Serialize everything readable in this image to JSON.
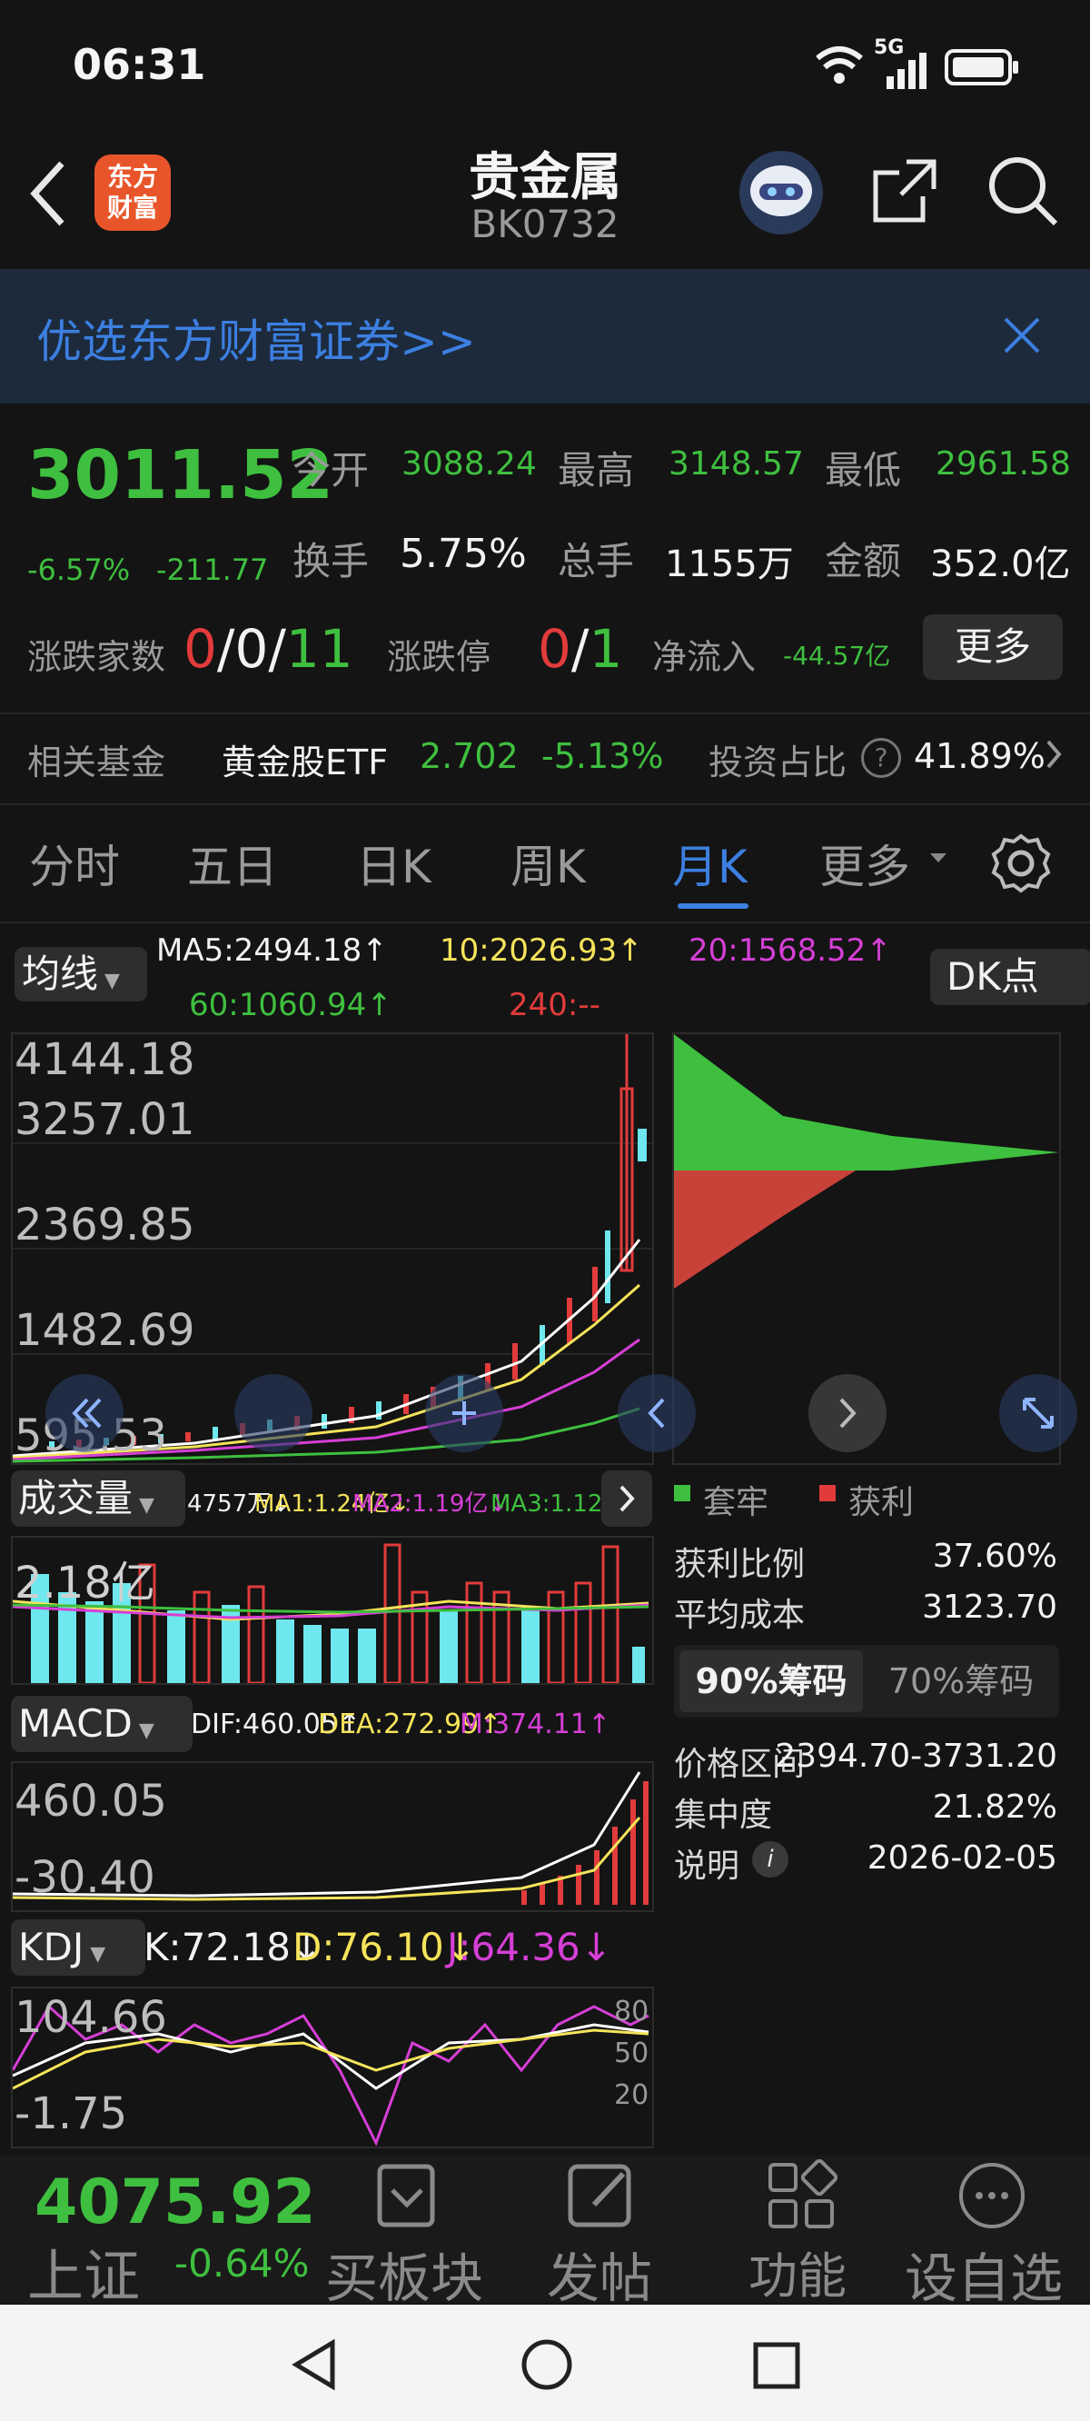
{
  "status_bar": {
    "time": "06:31",
    "network": "5G"
  },
  "header": {
    "title": "贵金属",
    "code": "BK0732",
    "logo_text_1": "东方",
    "logo_text_2": "财富"
  },
  "banner": {
    "text": "优选东方财富证券>>"
  },
  "quote": {
    "price": "3011.52",
    "change_pct": "-6.57%",
    "change": "-211.77",
    "open_label": "今开",
    "open": "3088.24",
    "high_label": "最高",
    "high": "3148.57",
    "low_label": "最低",
    "low": "2961.58",
    "turnover_label": "换手",
    "turnover": "5.75%",
    "volume_label": "总手",
    "volume": "1155万",
    "amount_label": "金额",
    "amount": "352.0亿",
    "updown_count_label": "涨跌家数",
    "up": "0",
    "flat": "0",
    "down": "11",
    "limit_label": "涨跌停",
    "limit_up": "0",
    "limit_down": "1",
    "netflow_label": "净流入",
    "netflow": "-44.57亿",
    "more_button": "更多"
  },
  "fund": {
    "label": "相关基金",
    "name": "黄金股ETF",
    "price": "2.702",
    "change": "-5.13%",
    "ratio_label": "投资占比",
    "ratio": "41.89%"
  },
  "tabs": [
    "分时",
    "五日",
    "日K",
    "周K",
    "月K",
    "更多"
  ],
  "ma": {
    "selector": "均线",
    "ma5": "MA5:2494.18↑",
    "ma10": "10:2026.93↑",
    "ma20": "20:1568.52↑",
    "ma60": "60:1060.94↑",
    "ma240": "240:--",
    "dk_button": "DK点"
  },
  "price_axis": [
    "4144.18",
    "3257.01",
    "2369.85",
    "1482.69",
    "595.53"
  ],
  "volume": {
    "selector": "成交量",
    "vol": "4757万↓",
    "ma1": "MA1:1.24亿↓",
    "ma2": "MA2:1.19亿↓",
    "ma3": "MA3:1.12亿↓",
    "axis": "2.18亿"
  },
  "macd": {
    "selector": "MACD",
    "dif": "DIF:460.05↑",
    "dea": "DEA:272.99↑",
    "m": "M:374.11↑",
    "axis_top": "460.05",
    "axis_bottom": "-30.40"
  },
  "kdj": {
    "selector": "KDJ",
    "k": "K:72.18↓",
    "d": "D:76.10↓",
    "j": "J:64.36↓",
    "axis_top": "104.66",
    "axis_bottom": "-1.75",
    "levels": [
      "80",
      "50",
      "20"
    ]
  },
  "chips": {
    "legend_trapped": "套牢",
    "legend_profit": "获利",
    "profit_ratio_label": "获利比例",
    "profit_ratio": "37.60%",
    "avg_cost_label": "平均成本",
    "avg_cost": "3123.70",
    "tab_90": "90%筹码",
    "tab_70": "70%筹码",
    "range_label": "价格区间",
    "range": "2394.70-3731.20",
    "concentration_label": "集中度",
    "concentration": "21.82%",
    "note_label": "说明",
    "date": "2026-02-05"
  },
  "bottom_bar": {
    "index_value": "4075.92",
    "index_name": "上证",
    "index_change": "-0.64%",
    "items": [
      "买板块",
      "发帖",
      "功能",
      "设自选"
    ]
  },
  "colors": {
    "up": "#e23b3b",
    "down": "#3fbf3f",
    "accent": "#3c7fe0",
    "ma5": "#ffffff",
    "ma10": "#f5e35a",
    "ma20": "#d63fd6",
    "ma60": "#3fbf3f",
    "volume_bar": "#6ee7ee"
  }
}
